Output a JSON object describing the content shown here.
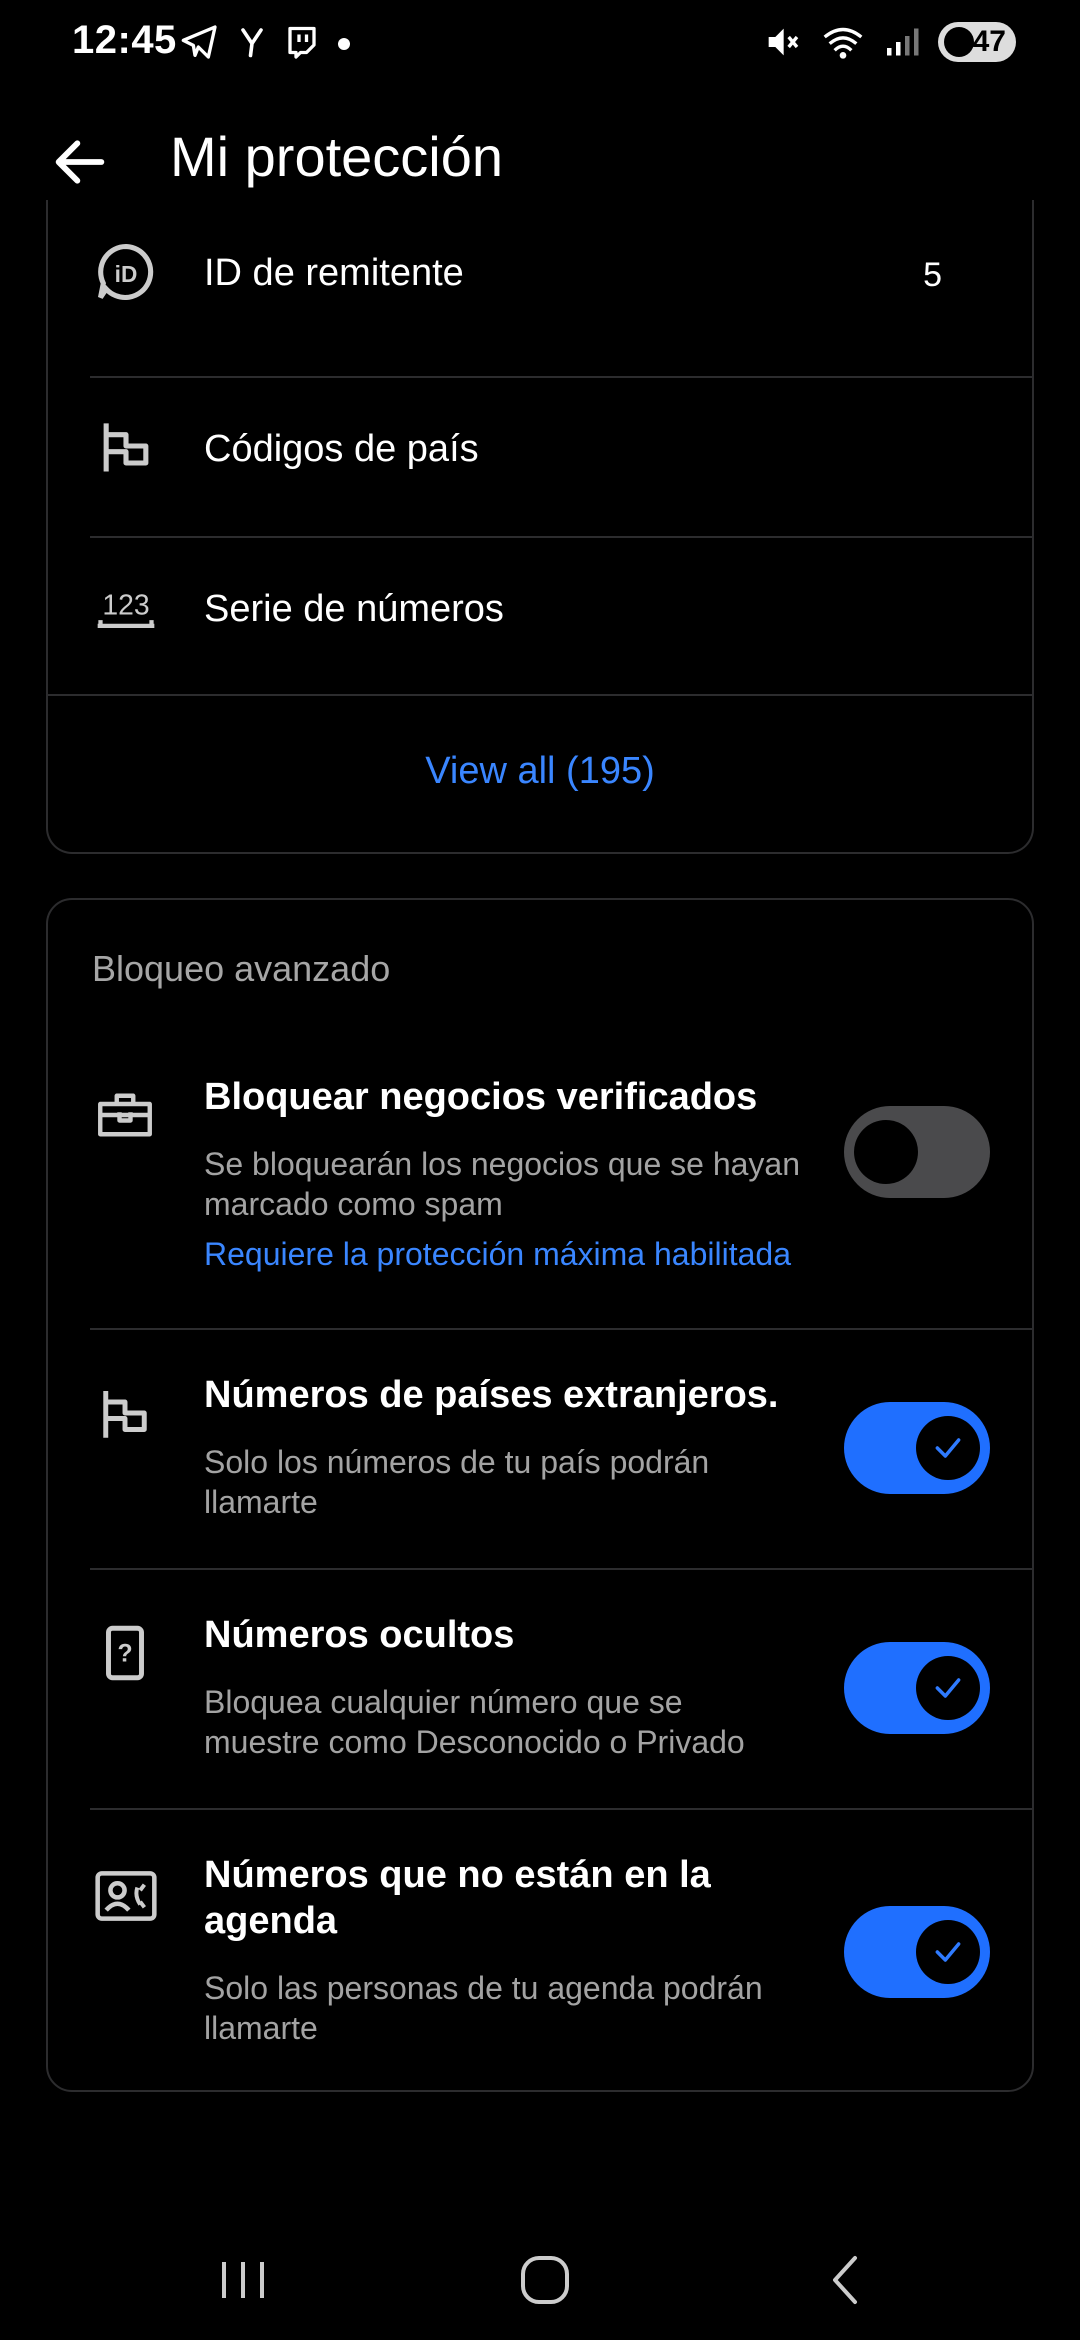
{
  "status_bar": {
    "time": "12:45",
    "battery": "47",
    "left_icons": [
      "telegram-icon",
      "yahoo-icon",
      "twitch-icon",
      "dot-icon"
    ],
    "right_icons": [
      "mute-icon",
      "wifi-icon",
      "signal-icon",
      "battery-icon"
    ]
  },
  "header": {
    "title": "Mi protección",
    "back_icon": "arrow-left-icon"
  },
  "list": {
    "items": [
      {
        "label": "ID de remitente",
        "count": "5",
        "icon": "caller-id-icon"
      },
      {
        "label": "Códigos de país",
        "count": "",
        "icon": "flag-icon"
      },
      {
        "label": "Serie de números",
        "count": "",
        "icon": "number-series-icon"
      }
    ],
    "view_all": "View all (195)"
  },
  "advanced": {
    "title": "Bloqueo avanzado",
    "items": [
      {
        "title": "Bloquear negocios verificados",
        "desc": "Se bloquearán los negocios que se hayan marcado como spam",
        "link": "Requiere la protección máxima habilitada",
        "enabled": false,
        "icon": "briefcase-icon"
      },
      {
        "title": "Números de países extranjeros.",
        "desc": "Solo los números de tu país podrán llamarte",
        "enabled": true,
        "icon": "flag-icon"
      },
      {
        "title": "Números ocultos",
        "desc": "Bloquea cualquier número que se muestre como Desconocido o Privado",
        "enabled": true,
        "icon": "hidden-number-icon"
      },
      {
        "title": "Números que no están en la agenda",
        "desc": "Solo las personas de tu agenda podrán llamarte",
        "enabled": true,
        "icon": "contact-card-icon"
      }
    ]
  },
  "colors": {
    "accent": "#1f6fff",
    "link": "#3a86ff",
    "background": "#000000",
    "border": "#2c2c2e"
  },
  "navbar": {
    "icons": [
      "recent-apps-icon",
      "home-icon",
      "back-icon"
    ]
  }
}
